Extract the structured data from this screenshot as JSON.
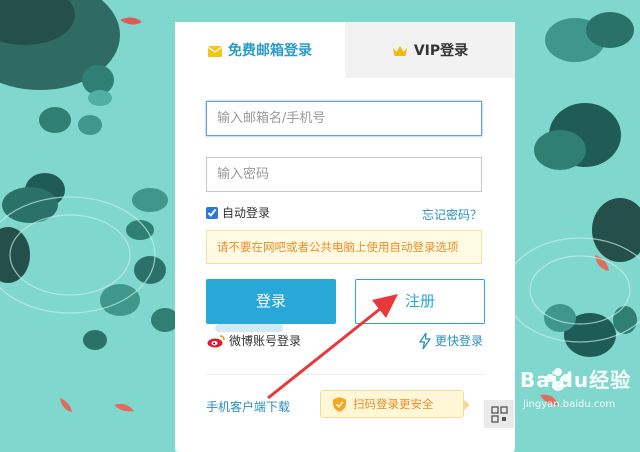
{
  "tabs": {
    "email_label": "免费邮箱登录",
    "vip_label": "VIP登录"
  },
  "form": {
    "email_placeholder": "输入邮箱名/手机号",
    "password_placeholder": "输入密码",
    "auto_login_label": "自动登录",
    "auto_login_checked": true,
    "forgot_label": "忘记密码？",
    "warning_text": "请不要在网吧或者公共电脑上使用自动登录选项",
    "login_button": "登录",
    "register_button": "注册",
    "weibo_label": "微博账号登录",
    "fast_login_label": "更快登录",
    "mobile_download_label": "手机客户端下载",
    "scan_tip": "扫码登录更安全"
  },
  "watermark": {
    "brand": "Baidu经验",
    "url": "jingyan.baidu.com"
  },
  "colors": {
    "accent": "#27a8d6",
    "warn_text": "#ee8d2d",
    "background": "#7fd7cd",
    "arrow": "#e8393a"
  }
}
